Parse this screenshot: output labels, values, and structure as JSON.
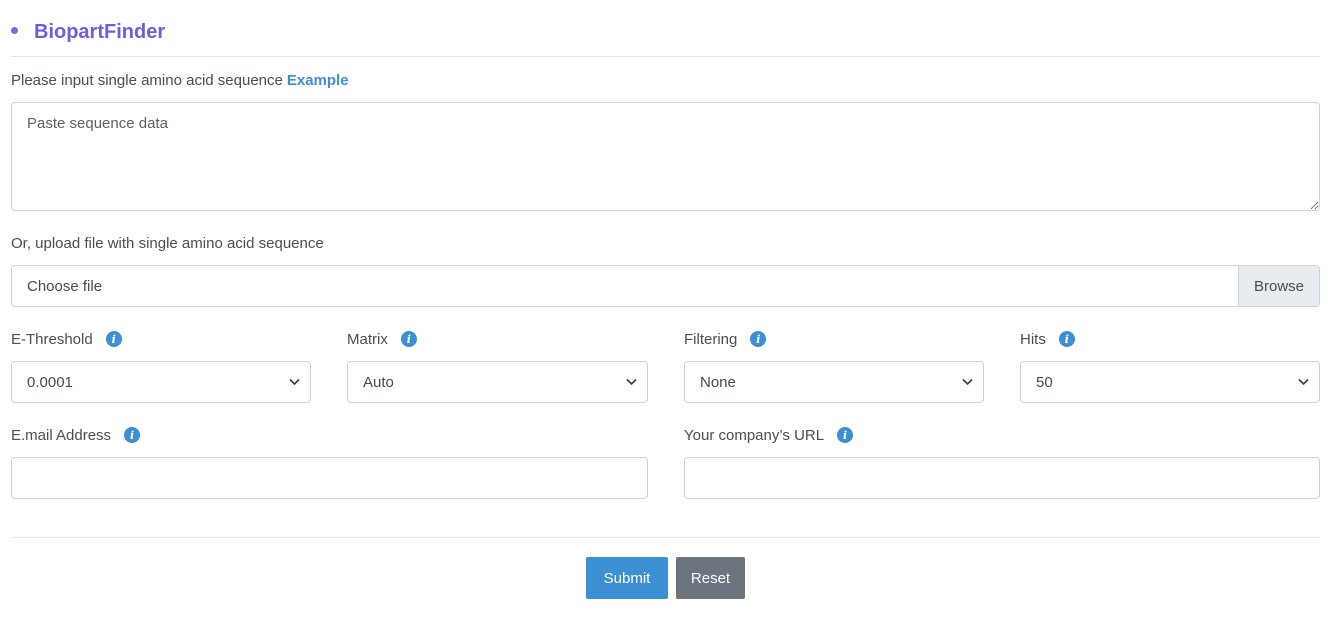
{
  "header": {
    "title": "BiopartFinder"
  },
  "sequence": {
    "label": "Please input single amino acid sequence",
    "example_link": "Example",
    "placeholder": "Paste sequence data"
  },
  "upload": {
    "label": "Or, upload file with single amino acid sequence",
    "file_text": "Choose file",
    "browse_label": "Browse"
  },
  "options": {
    "e_threshold": {
      "label": "E-Threshold",
      "value": "0.0001"
    },
    "matrix": {
      "label": "Matrix",
      "value": "Auto"
    },
    "filtering": {
      "label": "Filtering",
      "value": "None"
    },
    "hits": {
      "label": "Hits",
      "value": "50"
    }
  },
  "contact": {
    "email_label": "E.mail Address",
    "url_label": "Your company’s URL"
  },
  "actions": {
    "submit_label": "Submit",
    "reset_label": "Reset"
  },
  "icons": {
    "info": "info-icon",
    "dropdown": "chevron-down-icon",
    "bullet": "bullet-icon"
  },
  "colors": {
    "accent": "#3d8fd4",
    "title": "#6f5ce0",
    "reset": "#6c757d"
  }
}
